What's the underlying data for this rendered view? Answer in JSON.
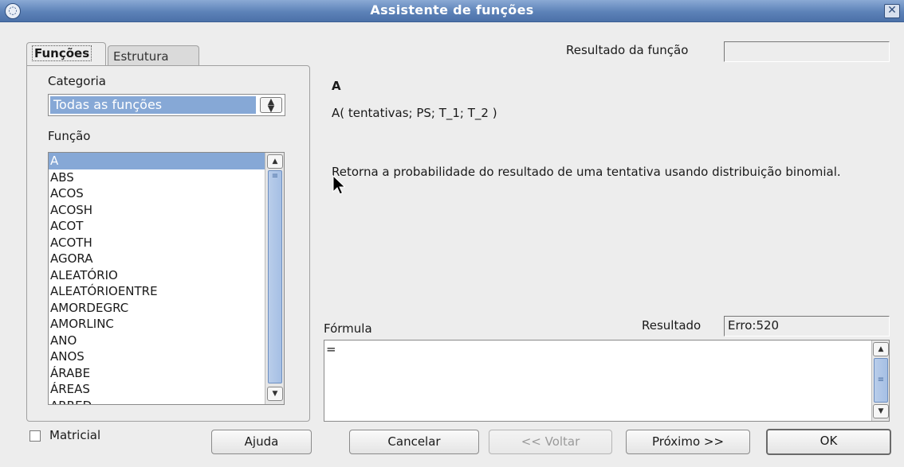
{
  "window": {
    "title": "Assistente de funções",
    "menu_icon": "window-menu-icon",
    "close_icon": "close-icon",
    "close_glyph": "✕"
  },
  "tabs": [
    {
      "label": "Funções",
      "active": true
    },
    {
      "label": "Estrutura",
      "active": false
    }
  ],
  "left": {
    "categoria_label": "Categoria",
    "categoria_value": "Todas as funções",
    "funcao_label": "Função",
    "functions": [
      "A",
      "ABS",
      "ACOS",
      "ACOSH",
      "ACOT",
      "ACOTH",
      "AGORA",
      "ALEATÓRIO",
      "ALEATÓRIOENTRE",
      "AMORDEGRC",
      "AMORLINC",
      "ANO",
      "ANOS",
      "ÁRABE",
      "ÁREAS",
      "ARRED"
    ],
    "selected_function": "A"
  },
  "right": {
    "resultado_funcao_label": "Resultado da função",
    "resultado_funcao_value": "",
    "function_name": "A",
    "function_syntax": "A( tentativas; PS; T_1; T_2 )",
    "function_description": "Retorna a probabilidade do resultado de uma tentativa usando distribuição binomial.",
    "formula_label": "Fórmula",
    "resultado_label": "Resultado",
    "resultado_value": "Erro:520",
    "formula_text": "="
  },
  "bottom": {
    "matricial_label": "Matricial",
    "matricial_checked": false,
    "ajuda_label": "Ajuda",
    "cancelar_label": "Cancelar",
    "voltar_label": "<< Voltar",
    "voltar_enabled": false,
    "proximo_label": "Próximo >>",
    "ok_label": "OK"
  },
  "colors": {
    "titlebar": "#5d82b8",
    "selection": "#86a8d6",
    "dialog_background": "#ededed"
  }
}
